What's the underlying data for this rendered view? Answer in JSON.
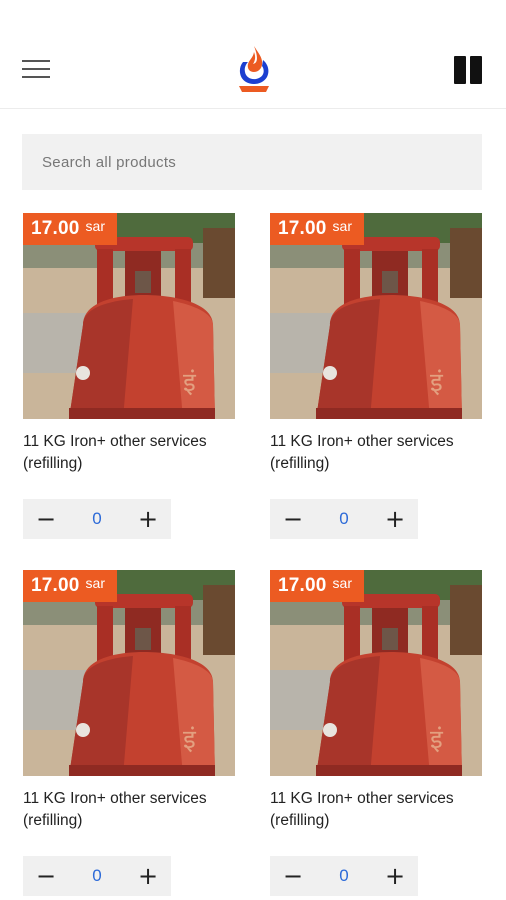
{
  "header": {
    "menu_icon": "hamburger-menu-icon",
    "logo": "flame-logo-icon",
    "pause_icon": "pause-icon",
    "logo_colors": {
      "flame": "#ec5b22",
      "ring": "#1c3fd0"
    }
  },
  "search": {
    "placeholder": "Search all products",
    "value": ""
  },
  "brand": {
    "accent": "#ec5b22",
    "qty_color": "#2c6ad8"
  },
  "products": [
    {
      "price": "17.00",
      "currency": "sar",
      "title": "11 KG Iron+ other services (refilling)",
      "qty": "0",
      "minus": "−",
      "plus": "+"
    },
    {
      "price": "17.00",
      "currency": "sar",
      "title": "11 KG Iron+ other services (refilling)",
      "qty": "0",
      "minus": "−",
      "plus": "+"
    },
    {
      "price": "17.00",
      "currency": "sar",
      "title": "11 KG Iron+ other services (refilling)",
      "qty": "0",
      "minus": "−",
      "plus": "+"
    },
    {
      "price": "17.00",
      "currency": "sar",
      "title": "11 KG Iron+ other services (refilling)",
      "qty": "0",
      "minus": "−",
      "plus": "+"
    }
  ]
}
